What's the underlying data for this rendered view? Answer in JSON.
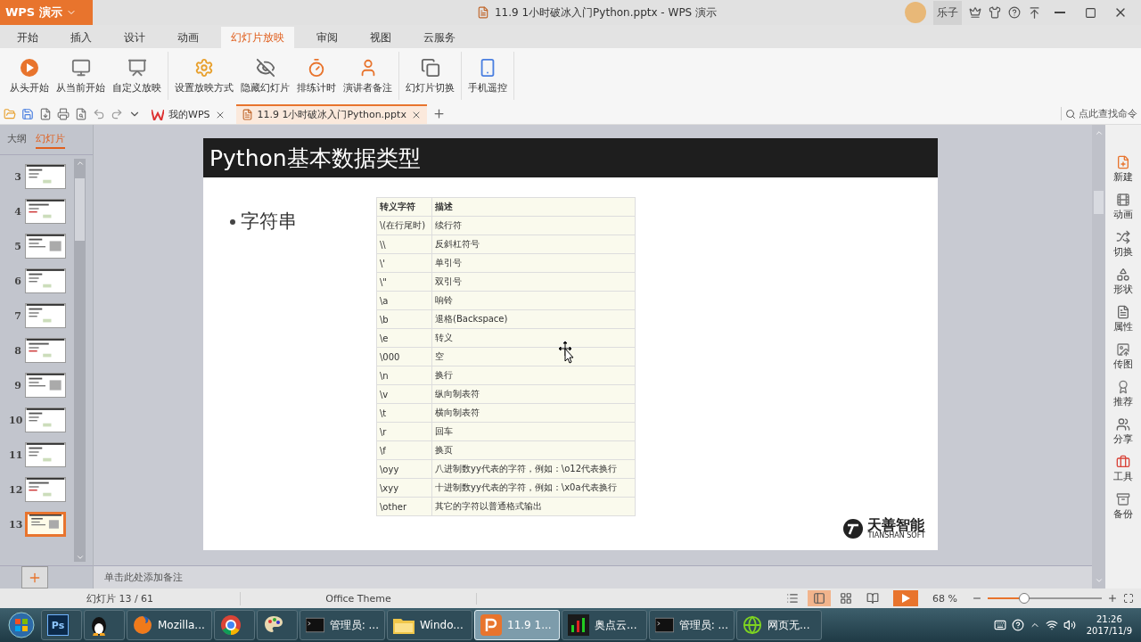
{
  "title_bar": {
    "app_button": "WPS 演示",
    "title": "11.9 1小时破冰入门Python.pptx - WPS 演示",
    "user": "乐子"
  },
  "menu": [
    {
      "label": "开始",
      "selected": false
    },
    {
      "label": "插入",
      "selected": false
    },
    {
      "label": "设计",
      "selected": false
    },
    {
      "label": "动画",
      "selected": false
    },
    {
      "label": "幻灯片放映",
      "selected": true
    },
    {
      "label": "审阅",
      "selected": false
    },
    {
      "label": "视图",
      "selected": false
    },
    {
      "label": "云服务",
      "selected": false
    }
  ],
  "ribbon": {
    "groups": [
      [
        "从头开始",
        "从当前开始",
        "自定义放映"
      ],
      [
        "设置放映方式",
        "隐藏幻灯片",
        "排练计时",
        "演讲者备注"
      ],
      [
        "幻灯片切换"
      ],
      [
        "手机遥控"
      ]
    ]
  },
  "doc_tabs": [
    {
      "label": "我的WPS",
      "selected": false
    },
    {
      "label": "11.9 1小时破冰入门Python.pptx",
      "selected": true
    }
  ],
  "command_search": {
    "placeholder": "点此查找命令"
  },
  "panel_tabs": [
    {
      "label": "大纲",
      "selected": false
    },
    {
      "label": "幻灯片",
      "selected": true
    }
  ],
  "thumbnails": [
    {
      "number": "3",
      "selected": false
    },
    {
      "number": "4",
      "selected": false
    },
    {
      "number": "5",
      "selected": false
    },
    {
      "number": "6",
      "selected": false
    },
    {
      "number": "7",
      "selected": false
    },
    {
      "number": "8",
      "selected": false
    },
    {
      "number": "9",
      "selected": false
    },
    {
      "number": "10",
      "selected": false
    },
    {
      "number": "11",
      "selected": false
    },
    {
      "number": "12",
      "selected": false
    },
    {
      "number": "13",
      "selected": true
    }
  ],
  "slide": {
    "title": "Python基本数据类型",
    "bullet": "字符串",
    "table": {
      "columns": [
        "转义字符",
        "描述"
      ],
      "rows": [
        [
          "\\(在行尾时)",
          "续行符"
        ],
        [
          "\\\\",
          "反斜杠符号"
        ],
        [
          "\\'",
          "单引号"
        ],
        [
          "\\\"",
          "双引号"
        ],
        [
          "\\a",
          "响铃"
        ],
        [
          "\\b",
          "退格(Backspace)"
        ],
        [
          "\\e",
          "转义"
        ],
        [
          "\\000",
          "空"
        ],
        [
          "\\n",
          "换行"
        ],
        [
          "\\v",
          "纵向制表符"
        ],
        [
          "\\t",
          "横向制表符"
        ],
        [
          "\\r",
          "回车"
        ],
        [
          "\\f",
          "换页"
        ],
        [
          "\\oyy",
          "八进制数yy代表的字符，例如：\\o12代表换行"
        ],
        [
          "\\xyy",
          "十进制数yy代表的字符，例如：\\x0a代表换行"
        ],
        [
          "\\other",
          "其它的字符以普通格式输出"
        ]
      ]
    },
    "logo": {
      "name": "天善智能",
      "subtitle": "TIANSHAN SOFT"
    }
  },
  "notes": {
    "placeholder": "单击此处添加备注"
  },
  "sidebar": [
    "新建",
    "动画",
    "切换",
    "形状",
    "属性",
    "传图",
    "推荐",
    "分享",
    "工具",
    "备份"
  ],
  "status_bar": {
    "slide_counter": "幻灯片 13 / 61",
    "theme": "Office Theme",
    "views": [
      {
        "kind": "notes",
        "selected": false
      },
      {
        "kind": "normal",
        "selected": true
      },
      {
        "kind": "sorter",
        "selected": false
      },
      {
        "kind": "reading",
        "selected": false
      }
    ],
    "zoom": "68 %",
    "zoom_slider": {
      "level": 0.32
    }
  },
  "taskbar": {
    "items": [
      {
        "kind": "start",
        "selected": false
      },
      {
        "kind": "photoshop",
        "icon_text": "Ps",
        "selected": false
      },
      {
        "kind": "qq",
        "selected": false
      },
      {
        "kind": "firefox",
        "label": "Mozilla...",
        "selected": false
      },
      {
        "kind": "chrome",
        "selected": false
      },
      {
        "kind": "paint",
        "selected": false
      },
      {
        "kind": "console",
        "label": "管理员: ...",
        "selected": false
      },
      {
        "kind": "folder",
        "label": "Windo...",
        "selected": false
      },
      {
        "kind": "wps",
        "label": "11.9 1...",
        "selected": true
      },
      {
        "kind": "stream",
        "label": "奥点云...",
        "selected": false
      },
      {
        "kind": "console",
        "label": "管理员: ...",
        "selected": false
      },
      {
        "kind": "web",
        "label": "网页无...",
        "selected": false
      }
    ],
    "clock": {
      "time": "21:26",
      "date": "2017/11/9"
    }
  }
}
